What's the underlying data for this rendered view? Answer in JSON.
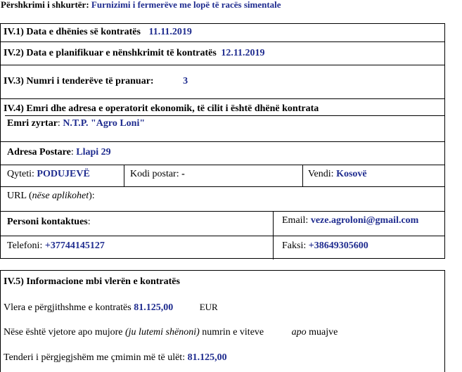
{
  "summary": {
    "label": "Përshkrimi i shkurtër:",
    "value": "Furnizimi i fermerëve me lopë të racës simentale"
  },
  "s41": {
    "label": "IV.1) Data e dhënies së kontratës",
    "value": "11.11.2019"
  },
  "s42": {
    "label": "IV.2) Data e planifikuar e nënshkrimit të kontratës",
    "value": "12.11.2019"
  },
  "s43": {
    "label": "IV.3) Numri i tenderëve të pranuar:",
    "value": "3"
  },
  "s44": {
    "label": "IV.4) Emri dhe adresa e operatorit ekonomik, të cilit i është dhënë kontrata",
    "official_name_label": "Emri zyrtar",
    "official_name": "N.T.P. \"Agro  Loni\"",
    "postal_address_label": "Adresa Postare",
    "postal_address": "Llapi 29",
    "city_label": "Qyteti:",
    "city": "PODUJEVË",
    "postal_code_label": "Kodi postar:",
    "postal_code": "-",
    "country_label": "Vendi:",
    "country": "Kosovë",
    "url_label": "URL (",
    "url_note": "nëse aplikohet",
    "url_close": "):",
    "contact_label": "Personi kontaktues",
    "email_label": "Email:",
    "email": "veze.agroloni@gmail.com",
    "phone_label": "Telefoni:",
    "phone": "+37744145127",
    "fax_label": "Faksi:",
    "fax": "+38649305600"
  },
  "s45": {
    "label": "IV.5) Informacione mbi vlerën e kontratës",
    "total_label": "Vlera e përgjithshme e kontratës",
    "total_value": "81.125,00",
    "currency": "EUR",
    "annual_label": "Nëse është vjetore apo mujore",
    "annual_note": "(ju lutemi shënoni)",
    "annual_rest": "numrin e viteve",
    "annual_or": "apo",
    "annual_months": "muajve",
    "lowest_label": "Tenderi i përgjegjshëm me çmimin më të ulët:",
    "lowest_value": "81.125,00"
  }
}
